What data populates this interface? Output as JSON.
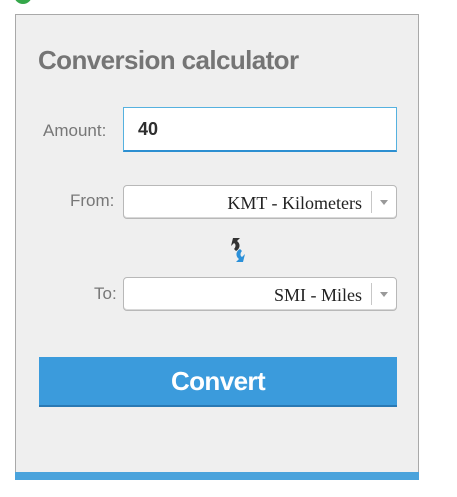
{
  "calculator": {
    "title": "Conversion calculator",
    "amount_label": "Amount:",
    "amount_value": "40",
    "from_label": "From:",
    "from_value": "KMT - Kilometers",
    "to_label": "To:",
    "to_value": "SMI - Miles",
    "convert_label": "Convert"
  },
  "icons": {
    "swap": "swap-arrows-icon",
    "dropdown": "chevron-down-icon"
  },
  "colors": {
    "panel_background": "#efefef",
    "accent_blue": "#3b9bdc",
    "input_border": "#55b1df",
    "title_gray": "#757575",
    "swap_dark": "#333333",
    "swap_blue": "#2b90d9"
  }
}
